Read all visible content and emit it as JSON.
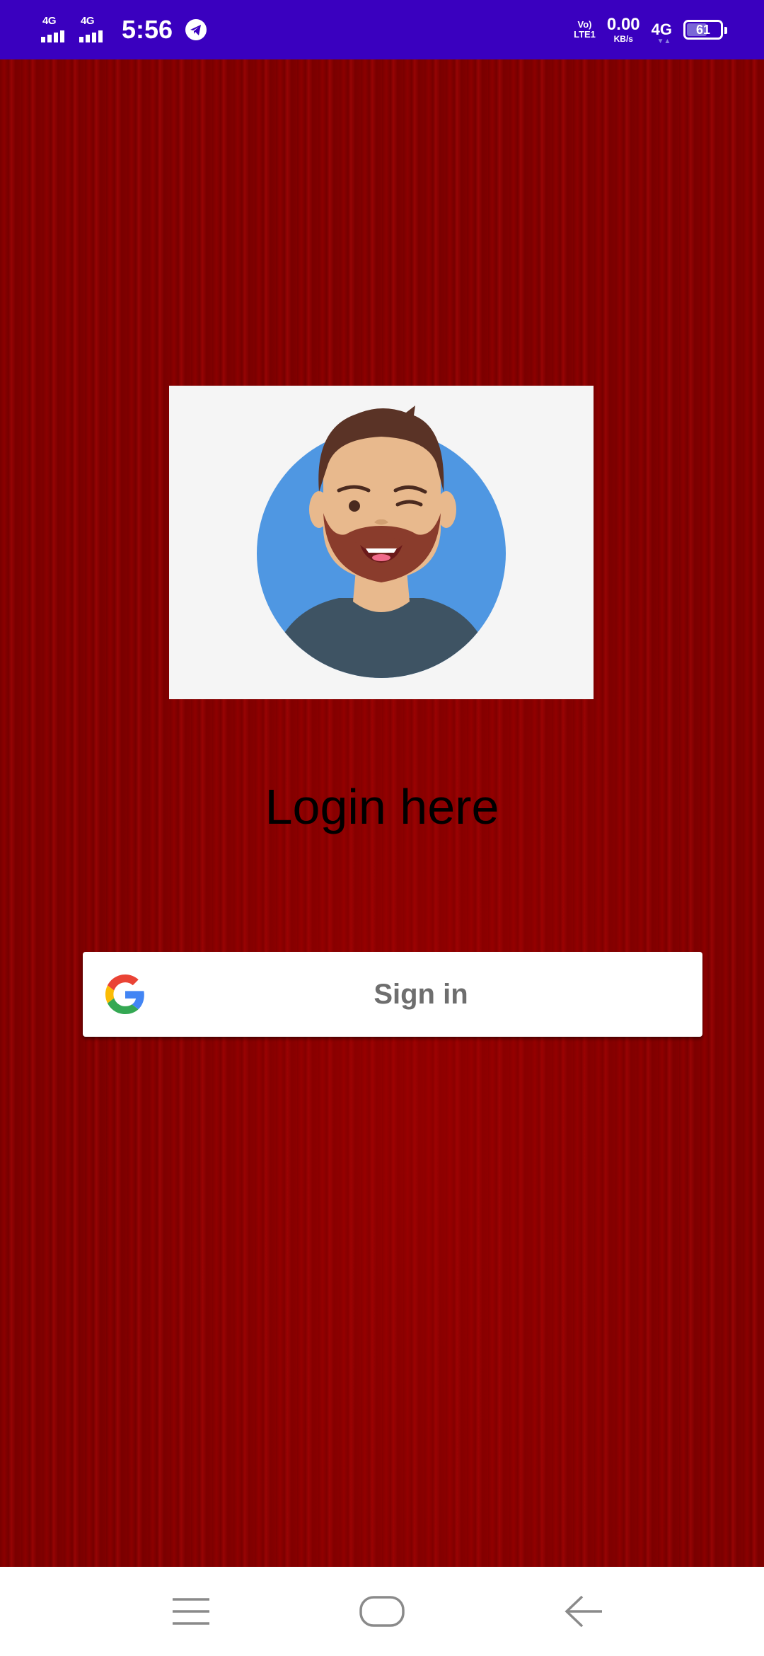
{
  "status_bar": {
    "network_1": "4G",
    "network_2": "4G",
    "time": "5:56",
    "volte_top": "Vo)",
    "volte_bottom": "LTE1",
    "speed_value": "0.00",
    "speed_unit": "KB/s",
    "network_3": "4G",
    "battery_level": "61",
    "battery_fraction": 0.61
  },
  "main": {
    "avatar_alt": "avatar-illustration",
    "title": "Login here",
    "signin_label": "Sign in",
    "signin_icon": "google-g-icon"
  },
  "nav_bar": {
    "menu_icon": "menu-icon",
    "home_icon": "home-icon",
    "back_icon": "back-icon"
  },
  "colors": {
    "status_bar": "#3a00bf",
    "background": "#7f0000",
    "button": "#ffffff",
    "button_text": "#6e6e6e"
  }
}
